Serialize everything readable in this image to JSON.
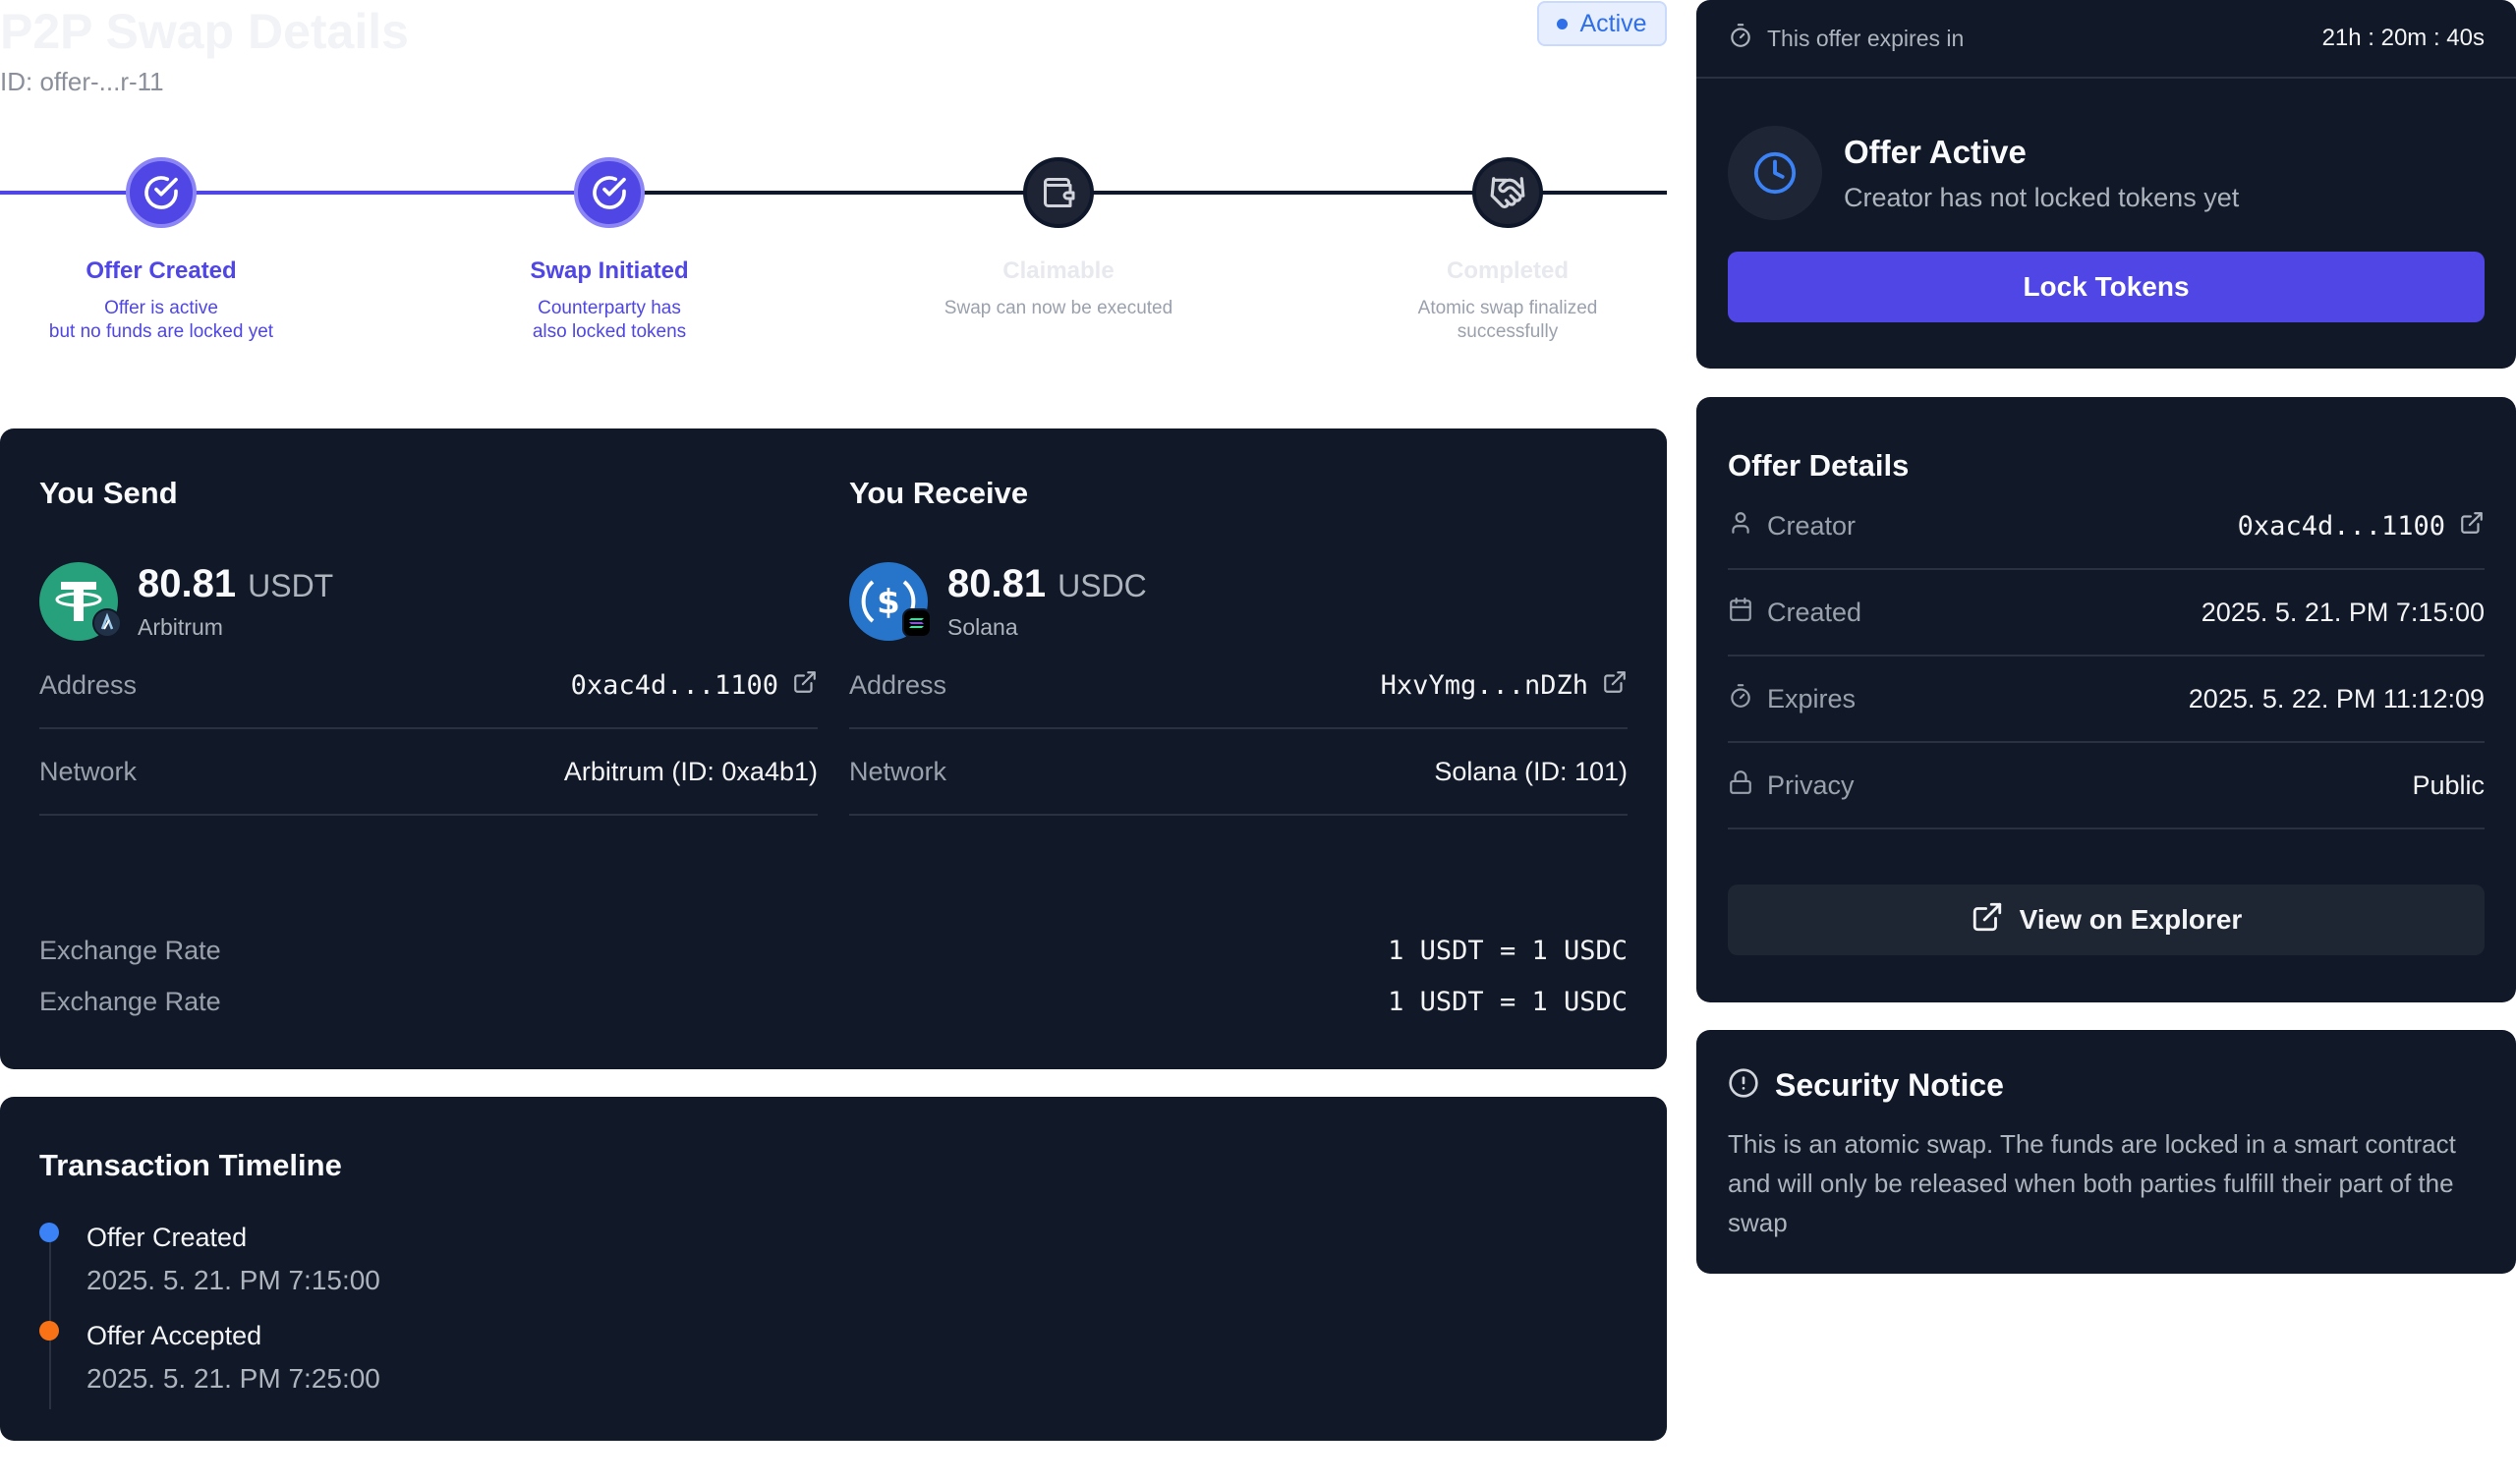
{
  "header": {
    "title": "P2P Swap Details",
    "id_text": "ID: offer-...r-11",
    "status": "Active",
    "status_color": "#2f6fe8"
  },
  "stepper": [
    {
      "label": "Offer Created",
      "desc_line1": "Offer is active",
      "desc_line2": "but no funds are locked yet",
      "state": "done",
      "icon": "check-circle-icon"
    },
    {
      "label": "Swap Initiated",
      "desc_line1": "Counterparty has",
      "desc_line2": "also locked tokens",
      "state": "done",
      "icon": "check-circle-icon"
    },
    {
      "label": "Claimable",
      "desc_line1": "Swap can now be executed",
      "desc_line2": "",
      "state": "pending",
      "icon": "wallet-icon"
    },
    {
      "label": "Completed",
      "desc_line1": "Atomic swap finalized",
      "desc_line2": "successfully",
      "state": "pending",
      "icon": "handshake-icon"
    }
  ],
  "send": {
    "title": "You Send",
    "amount": "80.81",
    "symbol": "USDT",
    "chain": "Arbitrum",
    "address_label": "Address",
    "address": "0xac4d...1100",
    "network_label": "Network",
    "network": "Arbitrum (ID: 0xa4b1)",
    "token_icon": "tether-icon",
    "chain_icon": "arbitrum-icon"
  },
  "receive": {
    "title": "You Receive",
    "amount": "80.81",
    "symbol": "USDC",
    "chain": "Solana",
    "address_label": "Address",
    "address": "HxvYmg...nDZh",
    "network_label": "Network",
    "network": "Solana (ID: 101)",
    "token_icon": "usdc-icon",
    "chain_icon": "solana-icon"
  },
  "exchange_rates": [
    {
      "label": "Exchange Rate",
      "value": "1 USDT = 1 USDC"
    },
    {
      "label": "Exchange Rate",
      "value": "1 USDT = 1 USDC"
    }
  ],
  "timeline": {
    "title": "Transaction Timeline",
    "events": [
      {
        "title": "Offer Created",
        "date": "2025. 5. 21. PM 7:15:00",
        "color": "#3b82f6"
      },
      {
        "title": "Offer Accepted",
        "date": "2025. 5. 21. PM 7:25:00",
        "color": "#f97316"
      }
    ]
  },
  "offer_status": {
    "expires_label": "This offer expires in",
    "expires_value": "21h : 20m : 40s",
    "title": "Offer Active",
    "subtitle": "Creator has not locked tokens yet",
    "button": "Lock Tokens",
    "accent": "#4f46e5"
  },
  "offer_details": {
    "title": "Offer Details",
    "rows": [
      {
        "label": "Creator",
        "value": "0xac4d...1100",
        "icon": "user-icon"
      },
      {
        "label": "Created",
        "value": "2025. 5. 21. PM 7:15:00",
        "icon": "calendar-icon"
      },
      {
        "label": "Expires",
        "value": "2025. 5. 22. PM 11:12:09",
        "icon": "timer-icon"
      },
      {
        "label": "Privacy",
        "value": "Public",
        "icon": "lock-icon"
      }
    ],
    "button": "View on Explorer"
  },
  "security": {
    "title": "Security Notice",
    "text": "This is an atomic swap. The funds are locked in a smart contract and will only be released when both parties fulfill their part of the swap"
  }
}
